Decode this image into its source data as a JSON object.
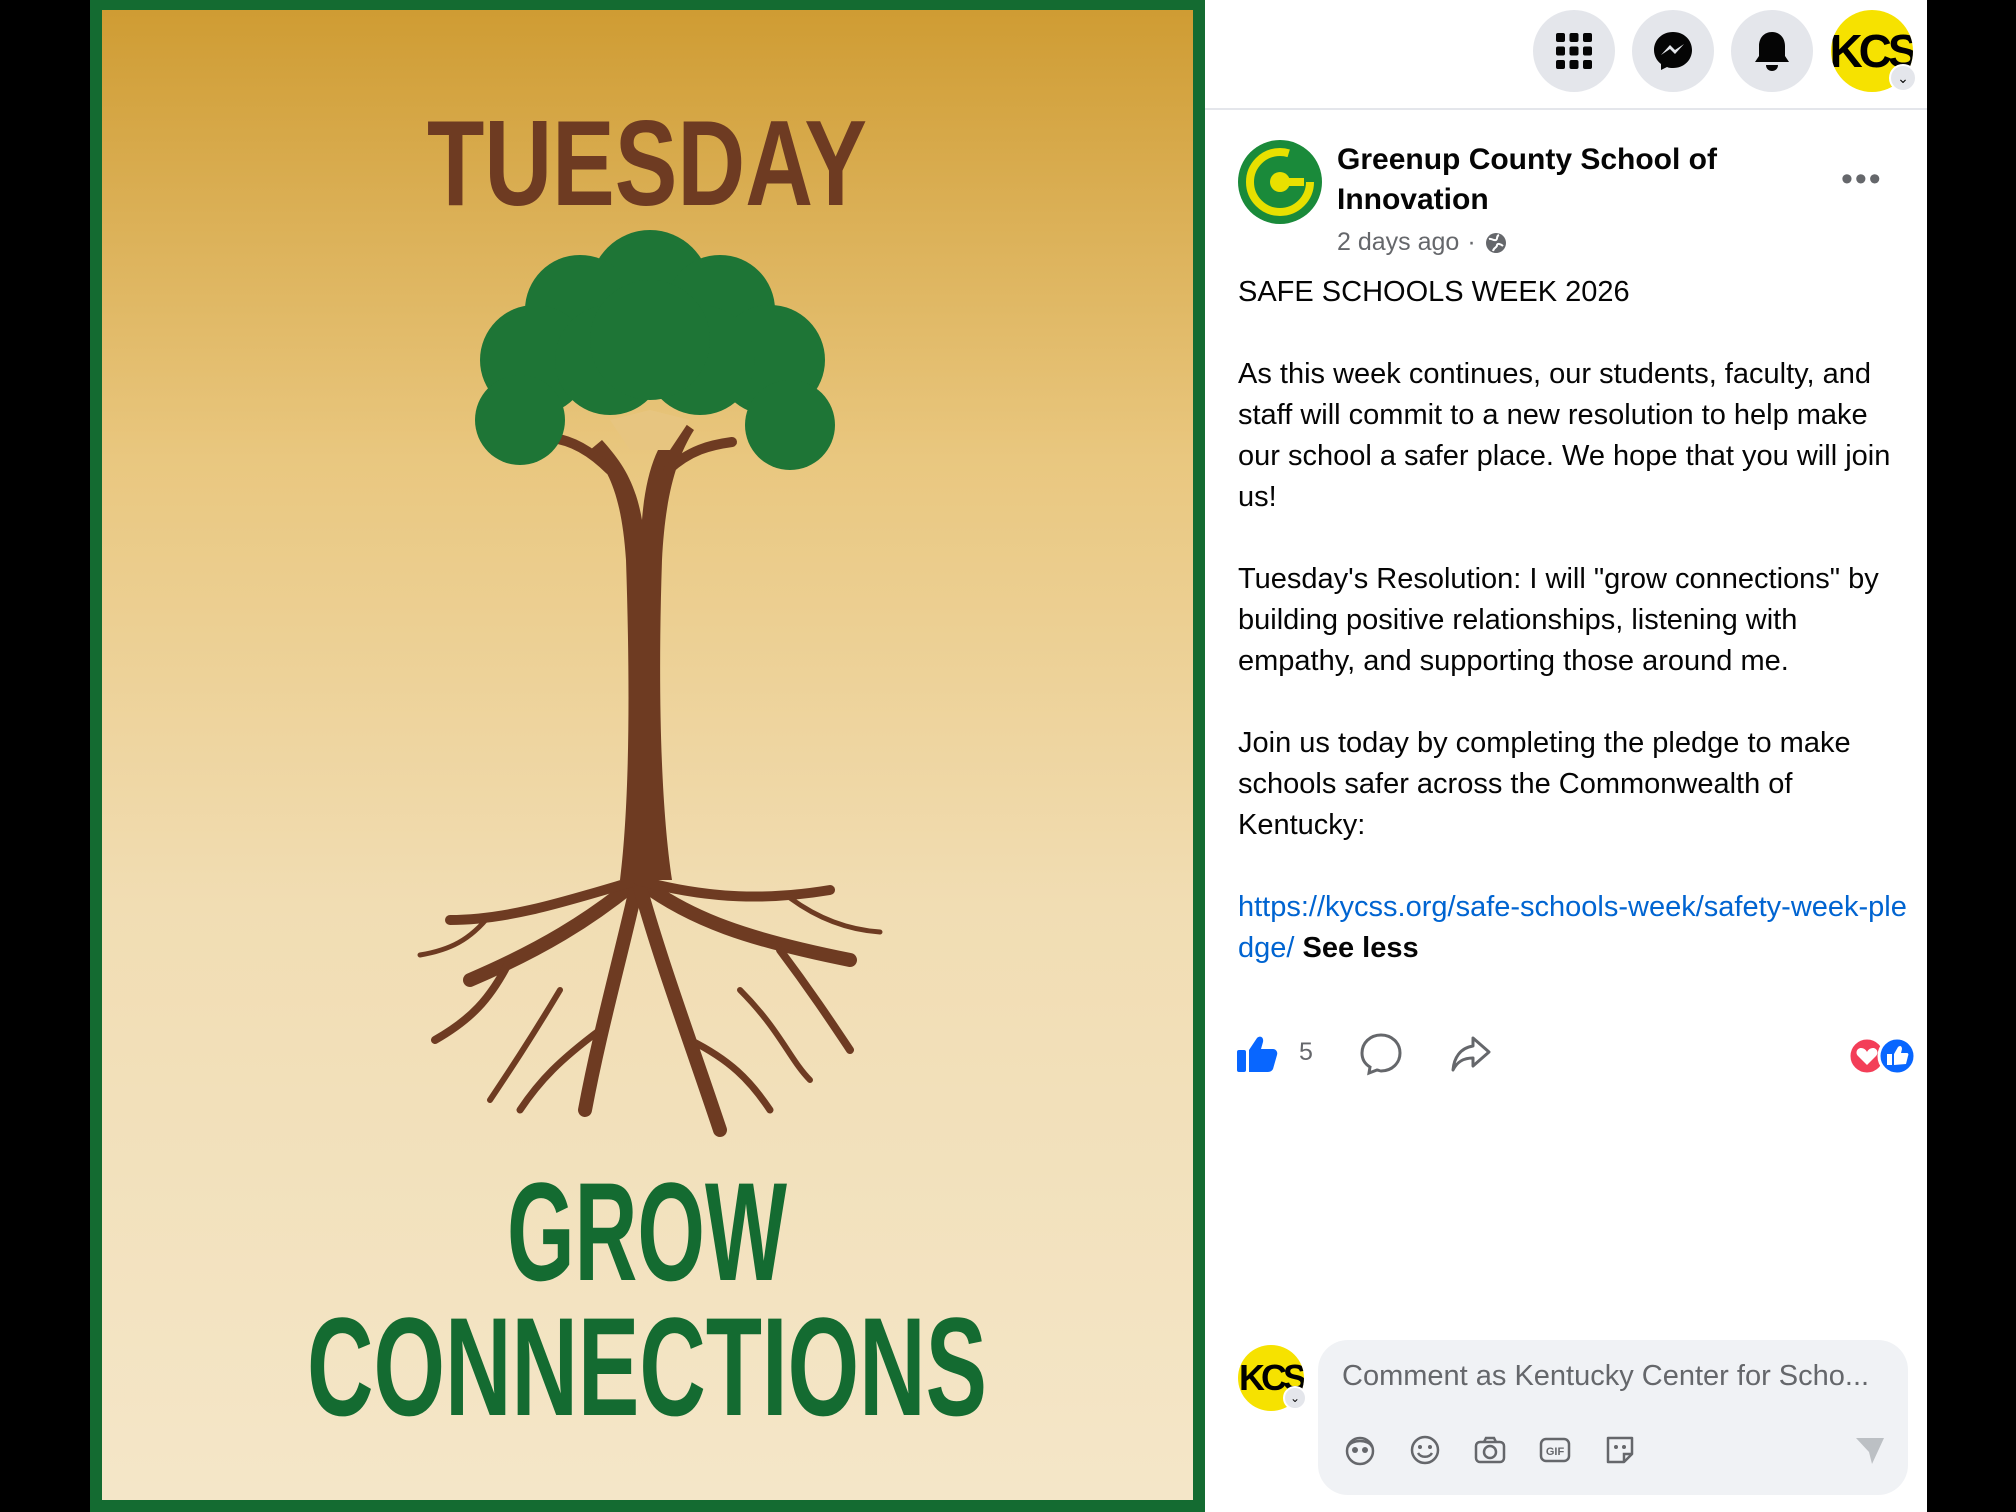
{
  "image": {
    "heading": "TUESDAY",
    "line1": "GROW",
    "line2": "CONNECTIONS"
  },
  "topbar": {
    "icons": [
      "apps-grid-icon",
      "messenger-icon",
      "notifications-bell-icon"
    ],
    "profile_avatar_text": "KCS"
  },
  "post": {
    "page_name": "Greenup County School of Innovation",
    "timestamp": "2 days ago",
    "separator": "·",
    "more_label": "•••",
    "title_line": "SAFE SCHOOLS WEEK 2026",
    "para1": "As this week continues, our students, faculty, and staff will commit to a new resolution to help make our school a safer place. We hope that you will join us!",
    "para2": "Tuesday's Resolution: I will \"grow connections\" by building positive relationships, listening with empathy, and supporting those around me.",
    "para3": "Join us today by completing the pledge to make schools safer across the Commonwealth of Kentucky:",
    "link": "https://kycss.org/safe-schools-week/safety-week-pledge/",
    "see_less": "See less"
  },
  "actions": {
    "like_count": "5"
  },
  "comment": {
    "placeholder": "Comment as Kentucky Center for Scho...",
    "avatar_text": "KCS"
  },
  "colors": {
    "green": "#146b31",
    "brown": "#6e3b22",
    "link_blue": "#0064d1",
    "like_blue": "#0866ff",
    "love_red": "#f33e58"
  }
}
